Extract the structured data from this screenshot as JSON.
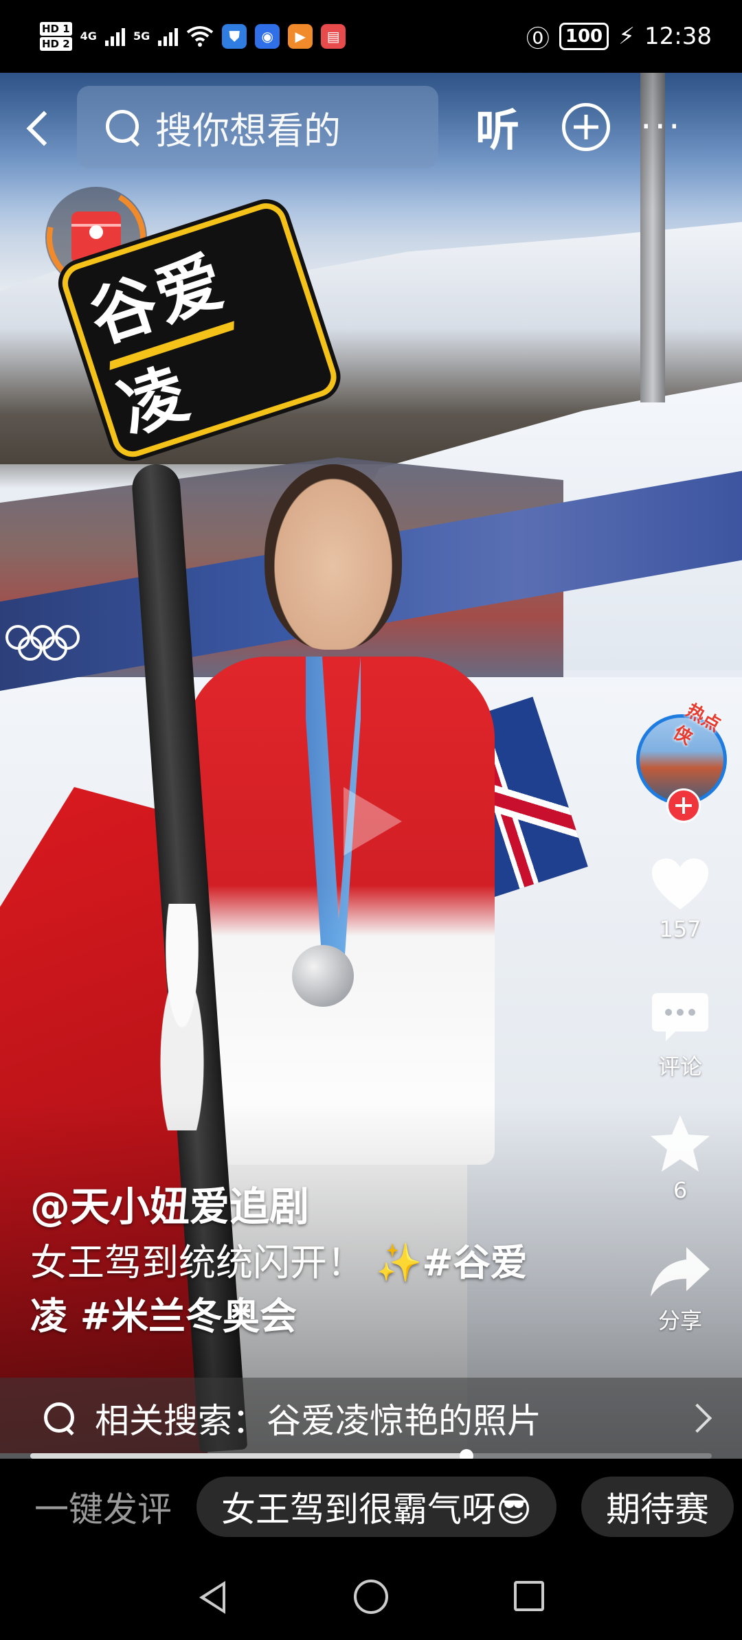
{
  "status_bar": {
    "sim1": "HD 1",
    "sim2": "HD 2",
    "net1": "4G",
    "net2": "5G",
    "battery": "100",
    "time": "12:38",
    "app_icons": [
      "shield-app-icon",
      "bulb-app-icon",
      "play-app-icon",
      "book-app-icon"
    ]
  },
  "top_nav": {
    "search_placeholder": "搜你想看的",
    "listen_label": "听",
    "more_label": "···"
  },
  "sticker": {
    "text": "谷爱凌"
  },
  "creator": {
    "avatar_badge": "热点侠"
  },
  "actions": {
    "like_count": "157",
    "comment_label": "评论",
    "favorite_count": "6",
    "share_label": "分享"
  },
  "post": {
    "author": "@天小妞爱追剧",
    "caption_line1": "女王驾到统统闪开！ ✨",
    "caption_tag1": "#谷爱",
    "caption_line2_tag": "凌 #米兰冬奥会"
  },
  "related_search": {
    "text": "相关搜索：谷爱凌惊艳的照片"
  },
  "playback": {
    "progress": 0.64
  },
  "quick_comments": {
    "label": "一键发评",
    "chips": [
      "女王驾到很霸气呀😎",
      "期待赛"
    ]
  },
  "colors": {
    "accent_red": "#f0353d",
    "sticker_yellow": "#f5c21a",
    "avatar_ring": "#1e7be0"
  }
}
